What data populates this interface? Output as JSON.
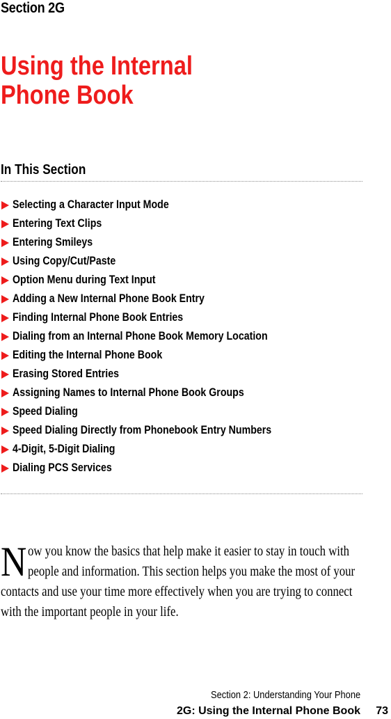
{
  "header": {
    "section_label": "Section 2G",
    "title_line1": "Using the Internal",
    "title_line2": "Phone Book"
  },
  "toc": {
    "heading": "In This Section",
    "items": [
      "Selecting a Character Input Mode",
      "Entering Text Clips",
      "Entering Smileys",
      "Using Copy/Cut/Paste",
      "Option Menu during Text Input",
      "Adding a New Internal Phone Book Entry",
      "Finding Internal Phone Book Entries",
      "Dialing from an Internal Phone Book Memory Location",
      "Editing the Internal Phone Book",
      "Erasing Stored Entries",
      "Assigning Names to Internal Phone Book Groups",
      "Speed Dialing",
      "Speed Dialing Directly from Phonebook Entry Numbers",
      "4-Digit, 5-Digit Dialing",
      "Dialing PCS Services"
    ]
  },
  "intro": {
    "drop_cap": "N",
    "text": "ow you know the basics that help make it easier to stay in touch with people and information. This section helps you make the most of your contacts and use your time more effectively when you are trying to connect with the important people in your life."
  },
  "footer": {
    "section": "Section 2: Understanding Your Phone",
    "chapter": "2G: Using the Internal Phone Book",
    "page_number": "73"
  },
  "colors": {
    "accent_red": "#ee1c1c",
    "text": "#000000",
    "rule": "#8a8a8a"
  }
}
